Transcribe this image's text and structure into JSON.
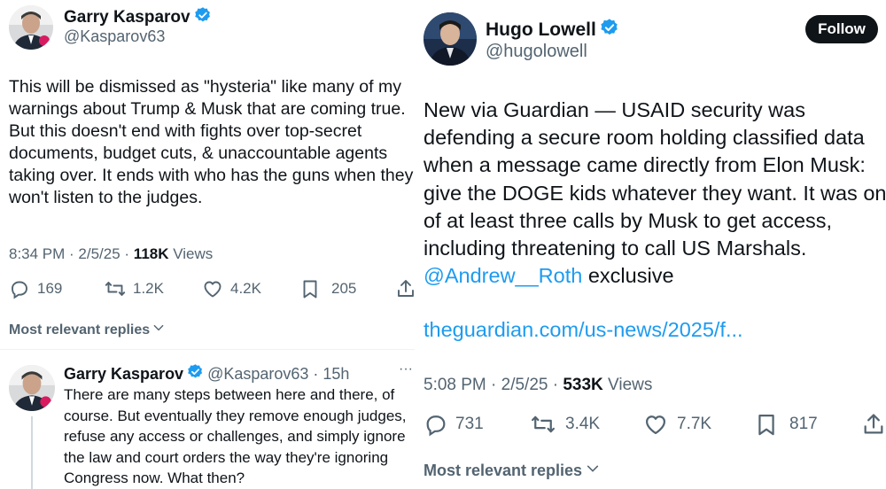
{
  "left": {
    "tweet": {
      "author_name": "Garry Kasparov",
      "handle": "@Kasparov63",
      "text": "This will be dismissed as \"hysteria\" like many of my warnings about Trump & Musk that are coming true. But this doesn't end with fights over top-secret documents, budget cuts, & unaccountable agents taking over. It ends with who has the guns when they won't listen to the judges.",
      "time": "8:34 PM · 2/5/25 · ",
      "views_count": "118K",
      "views_label": " Views",
      "replies": "169",
      "reposts": "1.2K",
      "likes": "4.2K",
      "bookmarks": "205"
    },
    "most_relevant": "Most relevant replies",
    "reply": {
      "author_name": "Garry Kasparov",
      "handle_time": "@Kasparov63 · 15h",
      "more": "···",
      "text": "There are many steps between here and there, of course. But eventually they remove enough judges, refuse any access or challenges, and simply ignore the law and court orders the way they're ignoring Congress now. What then?"
    }
  },
  "right": {
    "tweet": {
      "author_name": "Hugo Lowell",
      "handle": "@hugolowell",
      "follow_label": "Follow",
      "text_main": "New via Guardian — USAID security was defending a secure room holding classified data when a message came directly from Elon Musk: give the DOGE kids whatever they want. It was one of at least three calls by Musk to get access, including threatening to call US Marshals. ",
      "mention": "@Andrew__Roth",
      "text_end": " exclusive",
      "link": "theguardian.com/us-news/2025/f...",
      "time": "5:08 PM · 2/5/25 · ",
      "views_count": "533K",
      "views_label": " Views",
      "replies": "731",
      "reposts": "3.4K",
      "likes": "7.7K",
      "bookmarks": "817"
    },
    "most_relevant": "Most relevant replies"
  },
  "colors": {
    "text": "#0f1419",
    "secondary": "#536471",
    "link": "#1d9bf0",
    "verified": "#1d9bf0",
    "divider": "#eff3f4"
  },
  "icons": [
    "verified-badge-icon",
    "reply-icon",
    "repost-icon",
    "like-icon",
    "bookmark-icon",
    "share-icon",
    "chevron-down-icon",
    "more-icon"
  ]
}
